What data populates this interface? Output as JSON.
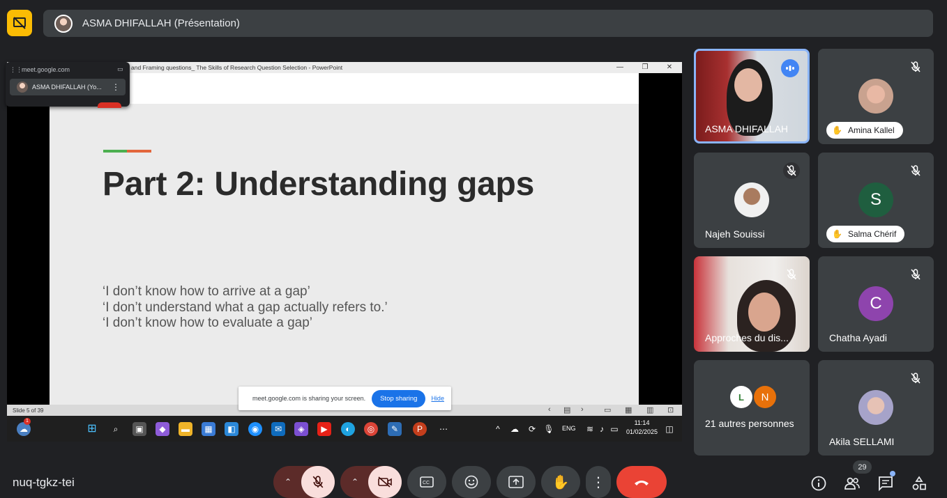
{
  "colors": {
    "accent_yellow": "#fbbc04",
    "surface": "#3c4043",
    "background": "#202124",
    "active_speaker": "#8ab4f8",
    "end_call": "#ea4335",
    "stop_sharing": "#1a73e8"
  },
  "header": {
    "presenter_label": "ASMA DHIFALLAH (Présentation)",
    "icon": "present-off-icon"
  },
  "mini_popup": {
    "url": "meet.google.com",
    "participant": "ASMA DHIFALLAH (Yo..."
  },
  "powerpoint": {
    "window_title": "and Framing questions_ The Skills of Research Question Selection - PowerPoint",
    "slide": {
      "heading": "Part 2: Understanding gaps",
      "lines": [
        "‘I don’t know how to arrive at a gap’",
        "‘I don’t understand what a gap actually refers to.’",
        "‘I don’t know how to evaluate a gap’"
      ]
    },
    "status": "Slide 5 of 39"
  },
  "share_banner": {
    "message": "meet.google.com is sharing your screen.",
    "stop": "Stop sharing",
    "hide": "Hide"
  },
  "taskbar": {
    "notification_badge": "1",
    "lang": "ENG",
    "time": "11:14",
    "date": "01/02/2025"
  },
  "participants": [
    {
      "name": "ASMA DHIFALLAH",
      "state": "speaking"
    },
    {
      "name": "Amina Kallel",
      "state": "muted",
      "hand_raised": true
    },
    {
      "name": "Najeh Souissi",
      "state": "muted"
    },
    {
      "name": "Salma Chérif",
      "state": "muted",
      "hand_raised": true,
      "initial": "S"
    },
    {
      "name": "Approches du dis...",
      "state": "muted"
    },
    {
      "name": "Chatha Ayadi",
      "state": "muted",
      "initial": "C"
    },
    {
      "name": "21 autres personnes",
      "initials": [
        "L",
        "N"
      ]
    },
    {
      "name": "Akila SELLAMI",
      "state": "muted"
    }
  ],
  "footer": {
    "meeting_code": "nuq-tgkz-tei",
    "people_count": "29"
  }
}
